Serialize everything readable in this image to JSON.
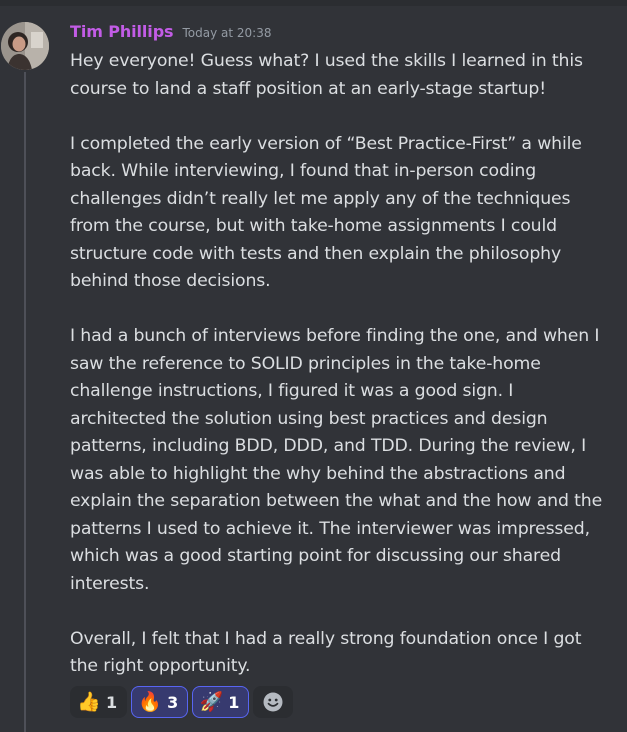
{
  "message": {
    "author": "Tim Phillips",
    "timestamp": "Today at 20:38",
    "paragraphs": [
      "Hey everyone! Guess what? I used the skills I learned in this course to land a staff position at an early-stage startup!",
      "I completed the early version of “Best Practice-First” a while back. While interviewing, I found that in-person coding challenges didn’t really let me apply any of the techniques from the course, but with take-home assignments I could structure code with tests and then explain the philosophy behind those decisions.",
      "I had a bunch of interviews before finding the one, and when I saw the reference to SOLID principles in the take-home challenge instructions, I figured it was a good sign. I architected the solution using best practices and design patterns, including BDD, DDD, and TDD. During the review, I was able to highlight the why behind the abstractions and explain the separation between the what and the how and the patterns I used to achieve it. The interviewer was impressed, which was a good starting point for discussing our shared interests.",
      "Overall, I felt that I had a really strong foundation once I got the right opportunity."
    ]
  },
  "reactions": [
    {
      "emoji": "👍",
      "icon": "thumbs-up-icon",
      "count": "1",
      "reacted": false
    },
    {
      "emoji": "🔥",
      "icon": "fire-icon",
      "count": "3",
      "reacted": true
    },
    {
      "emoji": "🚀",
      "icon": "rocket-icon",
      "count": "1",
      "reacted": true
    }
  ],
  "add_reaction": {
    "icon": "add-reaction-icon"
  },
  "colors": {
    "background": "#313338",
    "username": "#c25ce6",
    "timestamp": "#949ba4",
    "text": "#dbdee1",
    "reaction_bg": "#2b2d31",
    "reaction_active_bg": "#373a6f",
    "reaction_active_border": "#5865f2"
  }
}
